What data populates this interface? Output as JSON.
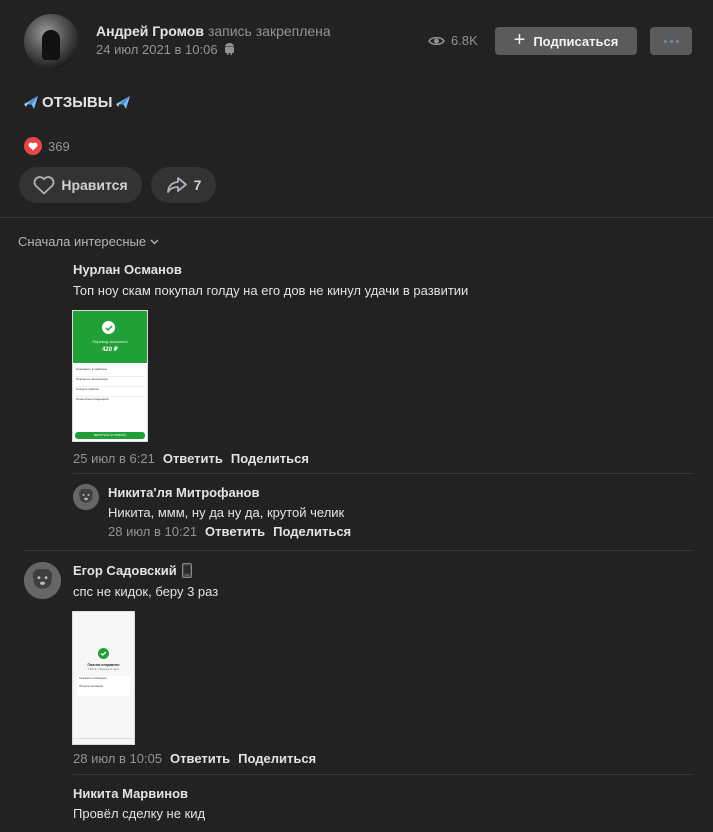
{
  "post": {
    "author": "Андрей Громов",
    "pinned_label": "запись закреплена",
    "date": "24 июл 2021 в 10:06",
    "views": "6.8K",
    "subscribe_label": "Подписаться",
    "text": "ОТЗЫВЫ",
    "likes_count": "369",
    "like_label": "Нравится",
    "shares_count": "7"
  },
  "comments_sort": "Сначала интересные",
  "comments": [
    {
      "author": "Нурлан Османов",
      "text": "Топ ноу скам покупал голду на его дов не кинул удачи в развитии",
      "date": "25 июл в 6:21",
      "reply_label": "Ответить",
      "share_label": "Поделиться",
      "attachment": {
        "title": "Перевод выполнен",
        "amount": "420 ₽",
        "items": [
          "Сохранить в шаблоны",
          "Повторить автоплатеж",
          "Создать шаблон",
          "Поделиться операцией"
        ],
        "button": "ВЕРНУТЬСЯ НА ГЛАВНУЮ"
      }
    },
    {
      "author": "Никита'ля Митрофанов",
      "text": "Никита, ммм, ну да ну да, крутой челик",
      "date": "28 июл в 10:21",
      "reply_label": "Ответить",
      "share_label": "Поделиться"
    },
    {
      "author": "Егор Садовский",
      "text": "спс не кидок, беру 3 раз",
      "date": "28 июл в 10:05",
      "reply_label": "Ответить",
      "share_label": "Поделиться",
      "attachment": {
        "title": "Платеж отправлен",
        "subtitle": "1 860 ₽ • Перевод по карте",
        "items": [
          "Сохранить в избранное",
          "Получить квитанцию"
        ]
      }
    },
    {
      "author": "Никита Марвинов",
      "text": "Провёл сделку не кид"
    }
  ],
  "colors": {
    "background": "#222222",
    "accent_button": "#5b5b5b",
    "like_red": "#e64646",
    "text_primary": "#e1e3e6",
    "text_secondary": "#939393",
    "sber_green": "#21a038"
  }
}
